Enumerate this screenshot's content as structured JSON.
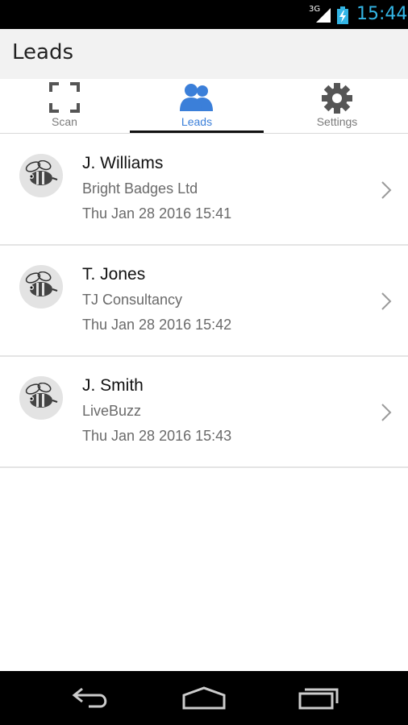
{
  "status_bar": {
    "network": "3G",
    "time": "15:44"
  },
  "action_bar": {
    "title": "Leads"
  },
  "tabs": [
    {
      "label": "Scan",
      "icon": "scan-icon",
      "selected": false
    },
    {
      "label": "Leads",
      "icon": "people-icon",
      "selected": true
    },
    {
      "label": "Settings",
      "icon": "gear-icon",
      "selected": false
    }
  ],
  "leads": [
    {
      "name": "J. Williams",
      "company": "Bright Badges Ltd",
      "date": "Thu Jan 28 2016 15:41"
    },
    {
      "name": "T. Jones",
      "company": "TJ Consultancy",
      "date": "Thu Jan 28 2016 15:42"
    },
    {
      "name": "J. Smith",
      "company": "LiveBuzz",
      "date": "Thu Jan 28 2016 15:43"
    }
  ],
  "colors": {
    "accent": "#3b7fd9",
    "status_time": "#33b5e5"
  }
}
